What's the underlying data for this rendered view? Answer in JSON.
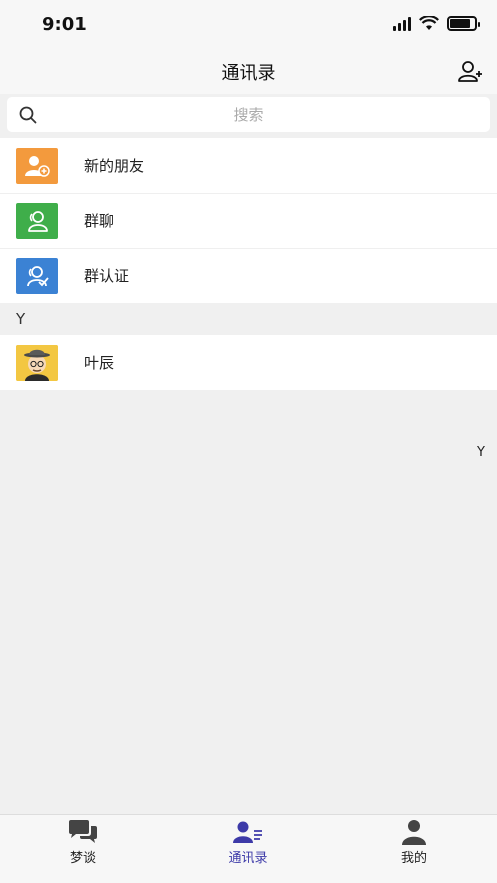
{
  "status_bar": {
    "time": "9:01"
  },
  "nav": {
    "title": "通讯录"
  },
  "search": {
    "placeholder": "搜索"
  },
  "entries": [
    {
      "label": "新的朋友",
      "icon": "add-friend-icon",
      "color": "#f39a3d"
    },
    {
      "label": "群聊",
      "icon": "group-chat-icon",
      "color": "#3fae4a"
    },
    {
      "label": "群认证",
      "icon": "group-verify-icon",
      "color": "#3b82d4"
    }
  ],
  "section": {
    "letter": "Y"
  },
  "contacts": [
    {
      "name": "叶辰",
      "avatar": "cartoon-avatar"
    }
  ],
  "index_bar": {
    "letter": "Y"
  },
  "tabs": [
    {
      "label": "梦谈",
      "icon": "chat-bubbles-icon",
      "active": false
    },
    {
      "label": "通讯录",
      "icon": "contacts-icon",
      "active": true
    },
    {
      "label": "我的",
      "icon": "profile-icon",
      "active": false
    }
  ],
  "colors": {
    "accent": "#3d3aa8",
    "background": "#f0f0f0"
  }
}
